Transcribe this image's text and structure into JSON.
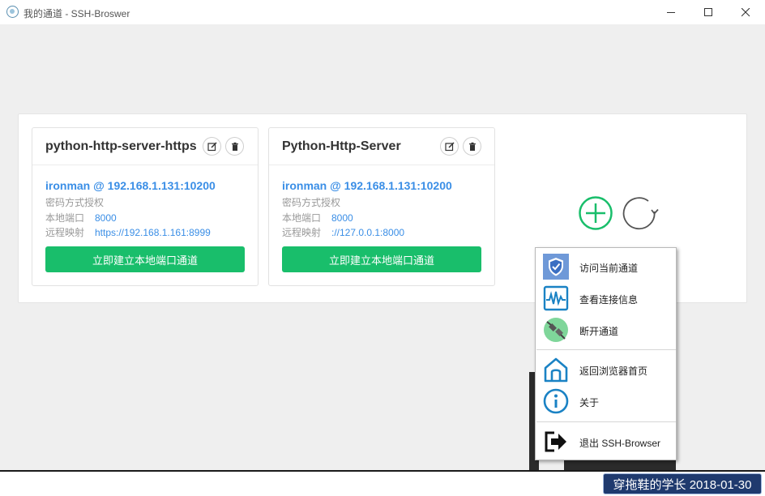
{
  "window": {
    "title": "我的通道 - SSH-Broswer"
  },
  "cards": [
    {
      "title": "python-http-server-https",
      "connection": "ironman @ 192.168.1.131:10200",
      "auth": "密码方式授权",
      "local_label": "本地端口",
      "local_value": "8000",
      "remote_label": "远程映射",
      "remote_value": "https://192.168.1.161:8999",
      "action_label": "立即建立本地端口通道"
    },
    {
      "title": "Python-Http-Server",
      "connection": "ironman @ 192.168.1.131:10200",
      "auth": "密码方式授权",
      "local_label": "本地端口",
      "local_value": "8000",
      "remote_label": "远程映射",
      "remote_value": "://127.0.0.1:8000",
      "action_label": "立即建立本地端口通道"
    }
  ],
  "context_menu": {
    "items": [
      {
        "label": "访问当前通道",
        "icon": "shield-icon"
      },
      {
        "label": "查看连接信息",
        "icon": "pulse-icon"
      },
      {
        "label": "断开通道",
        "icon": "plug-icon"
      },
      {
        "label": "返回浏览器首页",
        "icon": "home-icon"
      },
      {
        "label": "关于",
        "icon": "info-icon"
      },
      {
        "label": "退出 SSH-Browser",
        "icon": "exit-icon"
      }
    ]
  },
  "colors": {
    "accent_green": "#19be6b",
    "link_blue": "#3a8ee6",
    "watermark_bg": "#1f3a6e"
  },
  "watermark": {
    "text": "穿拖鞋的学长 2018-01-30"
  }
}
